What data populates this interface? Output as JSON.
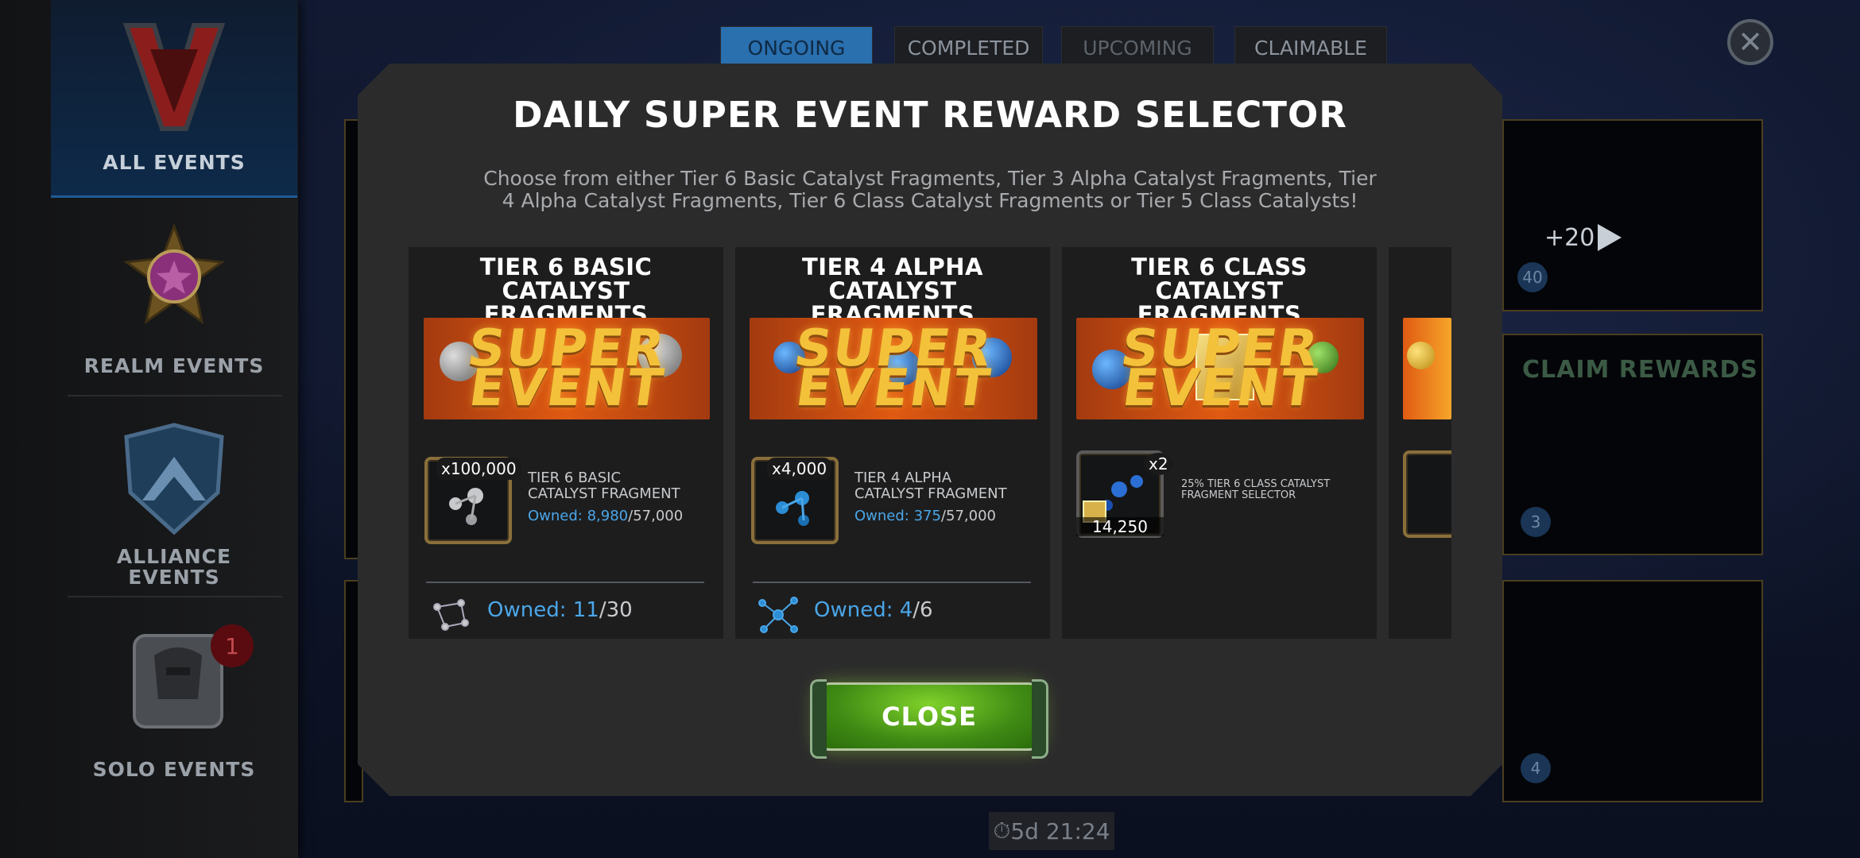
{
  "sidebar": {
    "items": [
      {
        "label": "ALL EVENTS"
      },
      {
        "label": "REALM EVENTS"
      },
      {
        "label": "ALLIANCE EVENTS"
      },
      {
        "label": "SOLO EVENTS",
        "badge": "1"
      }
    ]
  },
  "tabs": [
    "ONGOING",
    "COMPLETED",
    "UPCOMING",
    "CLAIMABLE"
  ],
  "background": {
    "plus_text": "+20",
    "claim_text": "CLAIM REWARDS",
    "badges": [
      "40",
      "3",
      "4"
    ],
    "timer": "5d 21:24"
  },
  "modal": {
    "title": "DAILY SUPER EVENT REWARD SELECTOR",
    "description": "Choose from either Tier 6 Basic Catalyst Fragments, Tier 3 Alpha Catalyst Fragments, Tier 4 Alpha Catalyst Fragments, Tier 6 Class Catalyst Fragments or Tier 5 Class Catalysts!",
    "banner_text_1": "SUPER",
    "banner_text_2": "EVENT",
    "cards": [
      {
        "title": "TIER 6 BASIC CATALYST FRAGMENTS",
        "qty": "x100,000",
        "item_name": "TIER 6 BASIC CATALYST FRAGMENT",
        "owned_label": "Owned: ",
        "owned_value": "8,980",
        "owned_total": "/57,000",
        "owned_big_label": "Owned: ",
        "owned_big_value": "11",
        "owned_big_total": "/30"
      },
      {
        "title": "TIER 4 ALPHA CATALYST FRAGMENTS",
        "qty": "x4,000",
        "item_name": "TIER 4 ALPHA CATALYST FRAGMENT",
        "owned_label": "Owned: ",
        "owned_value": "375",
        "owned_total": "/57,000",
        "owned_big_label": "Owned: ",
        "owned_big_value": "4",
        "owned_big_total": "/6"
      },
      {
        "title": "TIER 6 CLASS CATALYST FRAGMENTS",
        "qty": "x2",
        "count": "14,250",
        "item_name": "25% TIER 6 CLASS CATALYST FRAGMENT SELECTOR"
      }
    ],
    "close_label": "CLOSE"
  }
}
